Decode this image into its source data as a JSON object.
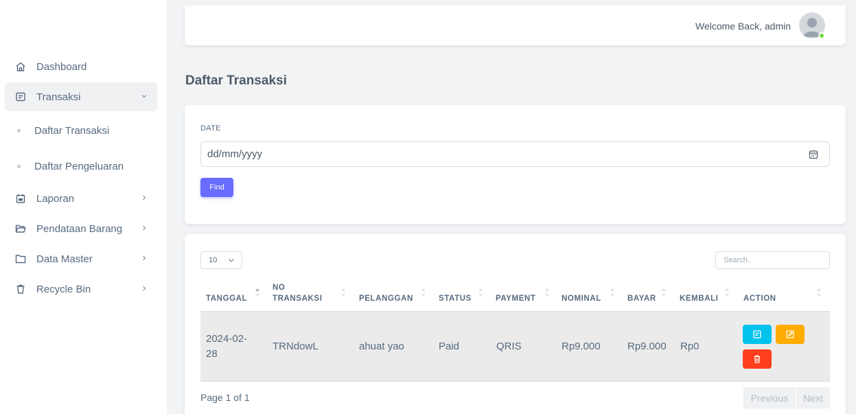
{
  "sidebar": {
    "items": [
      {
        "label": "Dashboard",
        "icon": "home-icon"
      },
      {
        "label": "Transaksi",
        "icon": "receipt-icon"
      },
      {
        "label": "Laporan",
        "icon": "calendar-icon"
      },
      {
        "label": "Pendataan Barang",
        "icon": "folder-open-icon"
      },
      {
        "label": "Data Master",
        "icon": "folder-icon"
      },
      {
        "label": "Recycle Bin",
        "icon": "trash-icon"
      }
    ],
    "sub_items": [
      {
        "label": "Daftar Transaksi"
      },
      {
        "label": "Daftar Pengeluaran"
      }
    ]
  },
  "header": {
    "welcome": "Welcome Back, admin"
  },
  "page": {
    "title": "Daftar Transaksi"
  },
  "filter": {
    "label": "DATE",
    "date_placeholder": "dd/mm/yyyy",
    "find_label": "Find"
  },
  "table": {
    "page_length": "10",
    "search_placeholder": "Search..",
    "columns": [
      "TANGGAL",
      "NO TRANSAKSI",
      "PELANGGAN",
      "STATUS",
      "PAYMENT",
      "NOMINAL",
      "BAYAR",
      "KEMBALI",
      "ACTION"
    ],
    "no_transaksi_line1": "NO",
    "no_transaksi_line2": "TRANSAKSI",
    "rows": [
      {
        "tanggal_line1": "2024-02-",
        "tanggal_line2": "28",
        "no_transaksi": "TRNdowL",
        "pelanggan": "ahuat yao",
        "status": "Paid",
        "payment": "QRIS",
        "nominal": "Rp9.000",
        "bayar": "Rp9.000",
        "kembali": "Rp0"
      }
    ],
    "page_info": "Page 1 of 1",
    "previous_label": "Previous",
    "next_label": "Next"
  },
  "colors": {
    "primary": "#696cff",
    "info": "#03c3ec",
    "warning": "#ffab00",
    "danger": "#ff3e1d",
    "online": "#71dd37"
  }
}
